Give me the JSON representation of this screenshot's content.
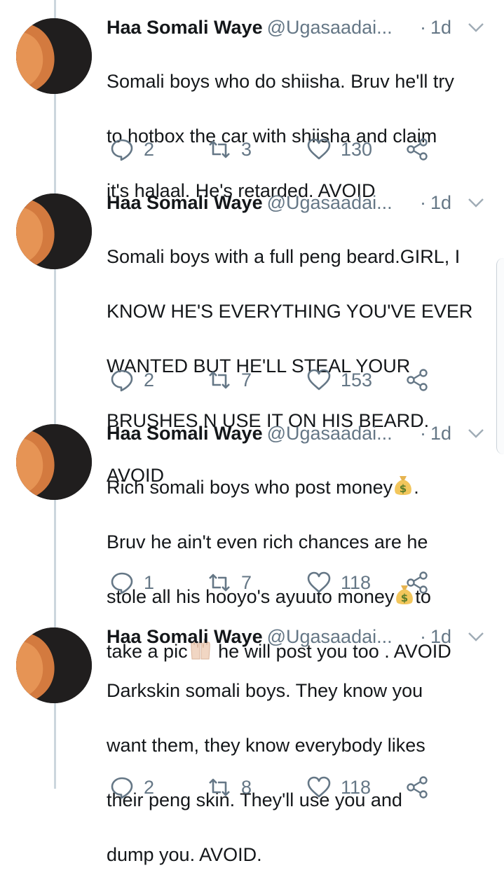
{
  "tweets": [
    {
      "author_name": "Haa Somali Waye",
      "handle": "@Ugasaadai...",
      "time": "1d",
      "lines": [
        "Somali boys who do shiisha. Bruv he'll try",
        "to hotbox the car with shiisha and claim",
        "it's halaal. He's retarded. AVOID"
      ],
      "replies": "2",
      "retweets": "3",
      "likes": "130"
    },
    {
      "author_name": "Haa Somali Waye",
      "handle": "@Ugasaadai...",
      "time": "1d",
      "lines": [
        "Somali boys with a full peng beard.GIRL, I",
        "KNOW HE'S EVERYTHING YOU'VE EVER",
        "WANTED BUT HE'LL STEAL YOUR",
        "BRUSHES N USE IT ON HIS BEARD.",
        "AVOID"
      ],
      "replies": "2",
      "retweets": "7",
      "likes": "153"
    },
    {
      "author_name": "Haa Somali Waye",
      "handle": "@Ugasaadai...",
      "time": "1d",
      "line1_before": "Rich somali boys who post money",
      "line1_after": ".",
      "line2": "Bruv he ain't even rich chances are he",
      "line3_before": "stole all his hooyo's ayuuto money",
      "line3_after": "to",
      "line4_before": "take a pic",
      "line4_after": " he will post you too . AVOID",
      "replies": "1",
      "retweets": "7",
      "likes": "118"
    },
    {
      "author_name": "Haa Somali Waye",
      "handle": "@Ugasaadai...",
      "time": "1d",
      "lines": [
        "Darkskin somali boys. They know you",
        "want them, they know everybody likes",
        "their peng skin. They'll use you and",
        "dump you. AVOID."
      ],
      "replies": "2",
      "retweets": "8",
      "likes": "118"
    }
  ],
  "icons": {
    "reply": "reply-icon",
    "retweet": "retweet-icon",
    "like": "heart-icon",
    "share": "share-icon",
    "caret": "chevron-down-icon",
    "money": "money-bag-emoji",
    "hands": "raising-hands-emoji"
  },
  "colors": {
    "text": "#14171a",
    "secondary": "#657786",
    "thread_line": "#ccd6dd"
  }
}
